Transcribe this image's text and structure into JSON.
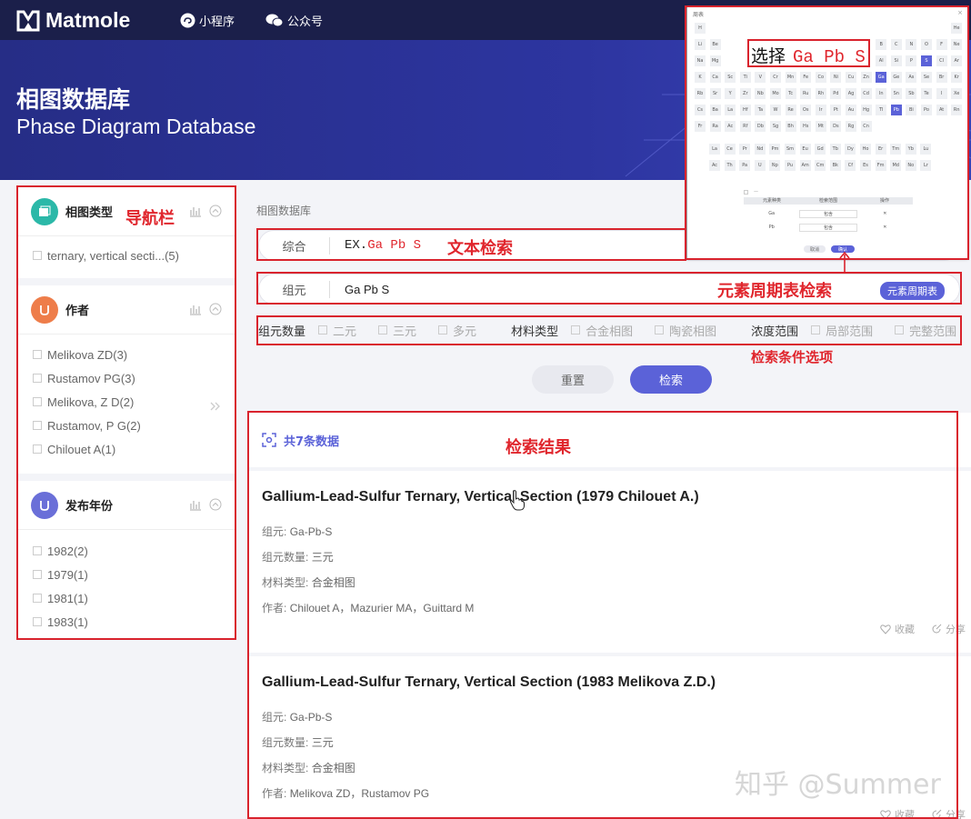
{
  "header": {
    "logo_text": "Matmole",
    "links": [
      "小程序",
      "公众号"
    ]
  },
  "banner": {
    "title": "相图数据库",
    "subtitle": "Phase Diagram Database"
  },
  "sidebar": {
    "sections": [
      {
        "title": "相图类型",
        "items": [
          "ternary, vertical secti...(5)"
        ]
      },
      {
        "title": "作者",
        "items": [
          "Melikova ZD(3)",
          "Rustamov PG(3)",
          "Melikova, Z D(2)",
          "Rustamov, P G(2)",
          "Chilouet A(1)"
        ]
      },
      {
        "title": "发布年份",
        "items": [
          "1982(2)",
          "1979(1)",
          "1981(1)",
          "1983(1)"
        ]
      }
    ]
  },
  "breadcrumb": "相图数据库",
  "text_search": {
    "label": "综合",
    "value": "EX.Ga Pb S"
  },
  "element_search": {
    "label": "组元",
    "value": "Ga Pb S",
    "button": "元素周期表"
  },
  "filters": {
    "groups": [
      {
        "label": "组元数量",
        "options": [
          "二元",
          "三元",
          "多元"
        ]
      },
      {
        "label": "材料类型",
        "options": [
          "合金相图",
          "陶瓷相图"
        ]
      },
      {
        "label": "浓度范围",
        "options": [
          "局部范围",
          "完整范围"
        ]
      }
    ]
  },
  "buttons": {
    "reset": "重置",
    "search": "检索"
  },
  "results": {
    "count_text": "共7条数据",
    "field_labels": {
      "components": "组元:",
      "count": "组元数量:",
      "material": "材料类型:",
      "authors": "作者:"
    },
    "actions": {
      "favorite": "收藏",
      "share": "分享"
    },
    "items": [
      {
        "title": "Gallium-Lead-Sulfur Ternary, Vertical Section (1979 Chilouet A.)",
        "components": "Ga-Pb-S",
        "count": "三元",
        "material": "合金相图",
        "authors": "Chilouet A，Mazurier MA，Guittard M"
      },
      {
        "title": "Gallium-Lead-Sulfur Ternary, Vertical Section (1983 Melikova Z.D.)",
        "components": "Ga-Pb-S",
        "count": "三元",
        "material": "合金相图",
        "authors": "Melikova ZD，Rustamov PG"
      }
    ]
  },
  "annotations": {
    "nav": "导航栏",
    "text_search": "文本检索",
    "element_search": "元素周期表检索",
    "filters": "检索条件选项",
    "results": "检索结果",
    "select": "选择",
    "select_value": "Ga Pb S"
  },
  "periodic_modal": {
    "title": "周表",
    "rows": [
      [
        "H",
        "",
        "",
        "",
        "",
        "",
        "",
        "",
        "",
        "",
        "",
        "",
        "",
        "",
        "",
        "",
        "",
        "He"
      ],
      [
        "Li",
        "Be",
        "",
        "",
        "",
        "",
        "",
        "",
        "",
        "",
        "",
        "",
        "B",
        "C",
        "N",
        "O",
        "F",
        "Ne"
      ],
      [
        "Na",
        "Mg",
        "",
        "",
        "",
        "",
        "",
        "",
        "",
        "",
        "",
        "",
        "Al",
        "Si",
        "P",
        "S",
        "Cl",
        "Ar"
      ],
      [
        "K",
        "Ca",
        "Sc",
        "Ti",
        "V",
        "Cr",
        "Mn",
        "Fe",
        "Co",
        "Ni",
        "Cu",
        "Zn",
        "Ga",
        "Ge",
        "As",
        "Se",
        "Br",
        "Kr"
      ],
      [
        "Rb",
        "Sr",
        "Y",
        "Zr",
        "Nb",
        "Mo",
        "Tc",
        "Ru",
        "Rh",
        "Pd",
        "Ag",
        "Cd",
        "In",
        "Sn",
        "Sb",
        "Te",
        "I",
        "Xe"
      ],
      [
        "Cs",
        "Ba",
        "La-Lu",
        "Hf",
        "Ta",
        "W",
        "Re",
        "Os",
        "Ir",
        "Pt",
        "Au",
        "Hg",
        "Tl",
        "Pb",
        "Bi",
        "Po",
        "At",
        "Rn"
      ],
      [
        "Fr",
        "Ra",
        "Ac-Lr",
        "Rf",
        "Db",
        "Sg",
        "Bh",
        "Hs",
        "Mt",
        "Ds",
        "Rg",
        "Cn",
        "",
        "",
        "",
        "",
        "",
        ""
      ]
    ],
    "lanthanides": [
      "La",
      "Ce",
      "Pr",
      "Nd",
      "Pm",
      "Sm",
      "Eu",
      "Gd",
      "Tb",
      "Dy",
      "Ho",
      "Er",
      "Tm",
      "Yb",
      "Lu"
    ],
    "actinides": [
      "Ac",
      "Th",
      "Pa",
      "U",
      "Np",
      "Pu",
      "Am",
      "Cm",
      "Bk",
      "Cf",
      "Es",
      "Fm",
      "Md",
      "No",
      "Lr"
    ],
    "selected": [
      "Ga",
      "Pb",
      "S"
    ],
    "table_headers": [
      "元素种类",
      "检索范围",
      "操作"
    ],
    "table_rows": [
      [
        "Ga",
        "包含"
      ],
      [
        "Pb",
        "包含"
      ]
    ],
    "cancel": "取消",
    "confirm": "确认"
  },
  "watermark": "知乎 @Summer"
}
